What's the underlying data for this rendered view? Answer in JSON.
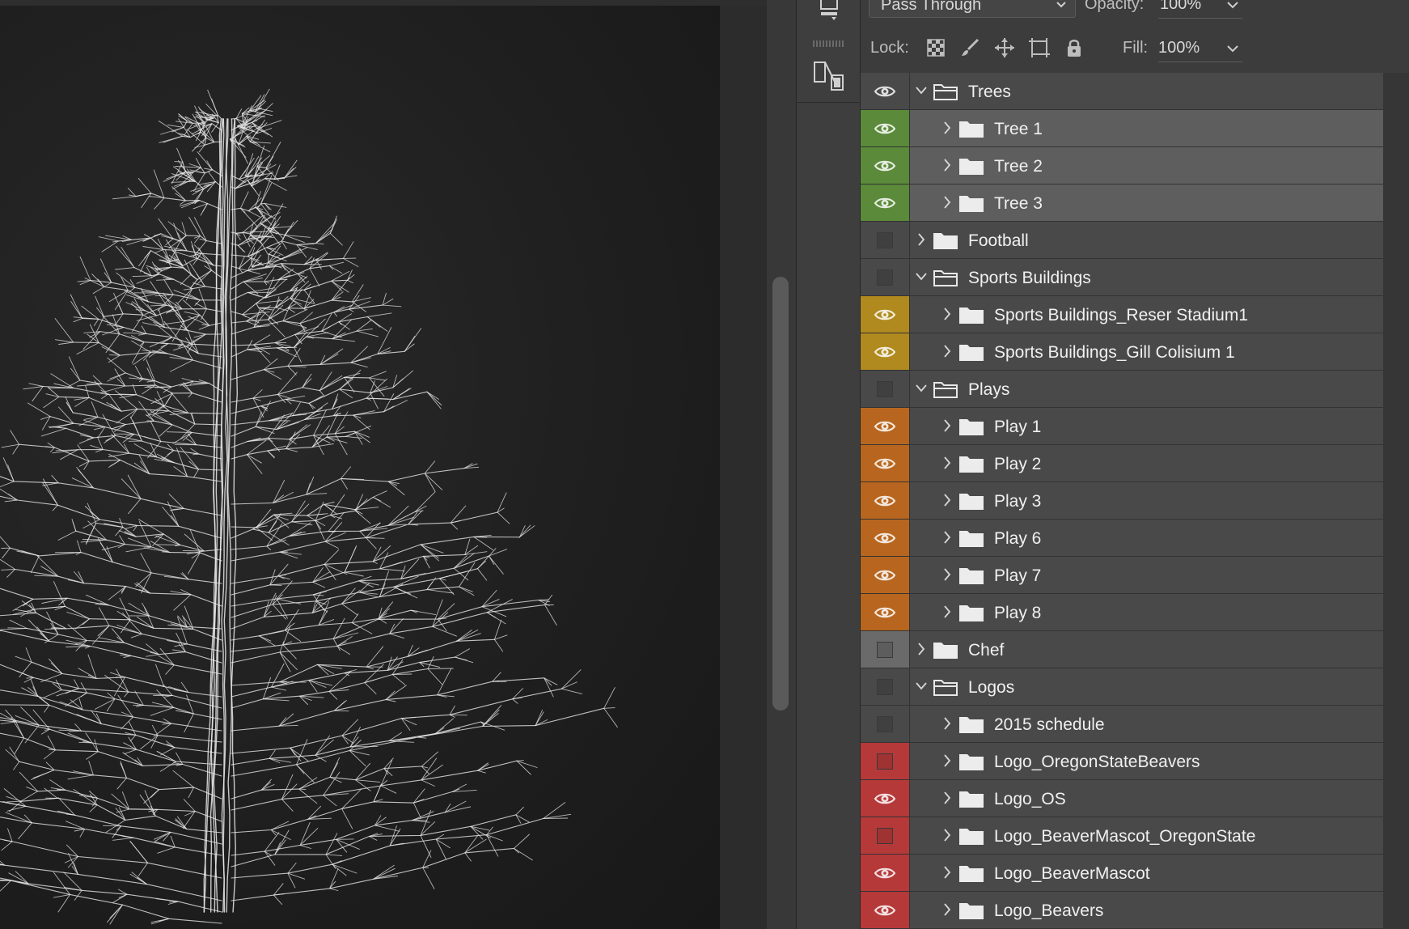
{
  "panel": {
    "blend_mode": "Pass Through",
    "opacity_label": "Opacity:",
    "opacity_value": "100%",
    "lock_label": "Lock:",
    "fill_label": "Fill:",
    "fill_value": "100%"
  },
  "colors": {
    "green": "#5b8a3a",
    "yellow": "#b08a1e",
    "orange": "#b8661f",
    "gray": "#6a6a6a",
    "red": "#b6393a"
  },
  "layers": [
    {
      "name": "Trees",
      "depth": 0,
      "expanded": true,
      "visible": true,
      "color": "none",
      "selected": false
    },
    {
      "name": "Tree 1",
      "depth": 1,
      "expanded": false,
      "visible": true,
      "color": "green",
      "selected": true
    },
    {
      "name": "Tree 2",
      "depth": 1,
      "expanded": false,
      "visible": true,
      "color": "green",
      "selected": true
    },
    {
      "name": "Tree 3",
      "depth": 1,
      "expanded": false,
      "visible": true,
      "color": "green",
      "selected": true
    },
    {
      "name": "Football",
      "depth": 0,
      "expanded": false,
      "visible": false,
      "color": "none",
      "selected": false
    },
    {
      "name": "Sports Buildings",
      "depth": 0,
      "expanded": true,
      "visible": false,
      "color": "none",
      "selected": false
    },
    {
      "name": "Sports Buildings_Reser Stadium1",
      "depth": 1,
      "expanded": false,
      "visible": true,
      "color": "yellow",
      "selected": false
    },
    {
      "name": "Sports Buildings_Gill Colisium 1",
      "depth": 1,
      "expanded": false,
      "visible": true,
      "color": "yellow",
      "selected": false
    },
    {
      "name": "Plays",
      "depth": 0,
      "expanded": true,
      "visible": false,
      "color": "none",
      "selected": false
    },
    {
      "name": "Play 1",
      "depth": 1,
      "expanded": false,
      "visible": true,
      "color": "orange",
      "selected": false
    },
    {
      "name": "Play 2",
      "depth": 1,
      "expanded": false,
      "visible": true,
      "color": "orange",
      "selected": false
    },
    {
      "name": "Play 3",
      "depth": 1,
      "expanded": false,
      "visible": true,
      "color": "orange",
      "selected": false
    },
    {
      "name": "Play 6",
      "depth": 1,
      "expanded": false,
      "visible": true,
      "color": "orange",
      "selected": false
    },
    {
      "name": "Play 7",
      "depth": 1,
      "expanded": false,
      "visible": true,
      "color": "orange",
      "selected": false
    },
    {
      "name": "Play 8",
      "depth": 1,
      "expanded": false,
      "visible": true,
      "color": "orange",
      "selected": false
    },
    {
      "name": "Chef",
      "depth": 0,
      "expanded": false,
      "visible": false,
      "color": "gray",
      "selected": false
    },
    {
      "name": "Logos",
      "depth": 0,
      "expanded": true,
      "visible": false,
      "color": "none",
      "selected": false
    },
    {
      "name": "2015 schedule",
      "depth": 1,
      "expanded": false,
      "visible": false,
      "color": "none",
      "selected": false
    },
    {
      "name": "Logo_OregonStateBeavers",
      "depth": 1,
      "expanded": false,
      "visible": false,
      "color": "red",
      "selected": false
    },
    {
      "name": "Logo_OS",
      "depth": 1,
      "expanded": false,
      "visible": true,
      "color": "red",
      "selected": false
    },
    {
      "name": "Logo_BeaverMascot_OregonState",
      "depth": 1,
      "expanded": false,
      "visible": false,
      "color": "red",
      "selected": false
    },
    {
      "name": "Logo_BeaverMascot",
      "depth": 1,
      "expanded": false,
      "visible": true,
      "color": "red",
      "selected": false
    },
    {
      "name": "Logo_Beavers",
      "depth": 1,
      "expanded": false,
      "visible": true,
      "color": "red",
      "selected": false
    }
  ]
}
